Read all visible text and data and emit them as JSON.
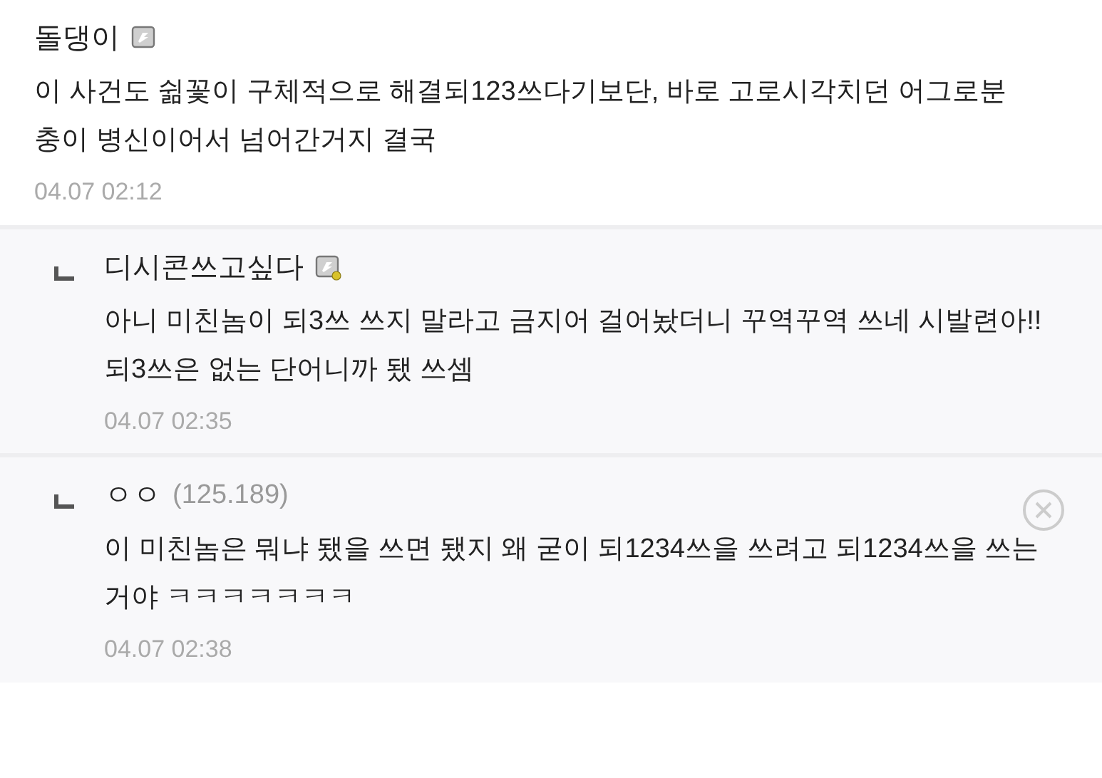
{
  "comments": [
    {
      "kind": "comment",
      "author": "돌댕이",
      "nick_badge": true,
      "badge_dot": false,
      "paragraphs": [
        "이 사건도 쉶꽃이 구체적으로 해결되123쓰다기보단, 바로 고로시각치던 어그로분충이 병신이어서 넘어간거지 결국"
      ],
      "time": "04.07 02:12"
    },
    {
      "kind": "reply",
      "author": "디시콘쓰고싶다",
      "nick_badge": true,
      "badge_dot": true,
      "paragraphs": [
        "아니 미친놈이 되3쓰 쓰지 말라고 금지어 걸어놨더니 꾸역꾸역 쓰네 시발련아!!",
        "되3쓰은 없는 단어니까 됐 쓰셈"
      ],
      "time": "04.07 02:35"
    },
    {
      "kind": "reply",
      "author": "ㅇㅇ",
      "ip": "(125.189)",
      "deletable": true,
      "paragraphs": [
        "이 미친놈은 뭐냐 됐을 쓰면 됐지 왜 굳이 되1234쓰을 쓰려고 되1234쓰을 쓰는거야 ㅋㅋㅋㅋㅋㅋㅋ"
      ],
      "time": "04.07 02:38"
    }
  ]
}
